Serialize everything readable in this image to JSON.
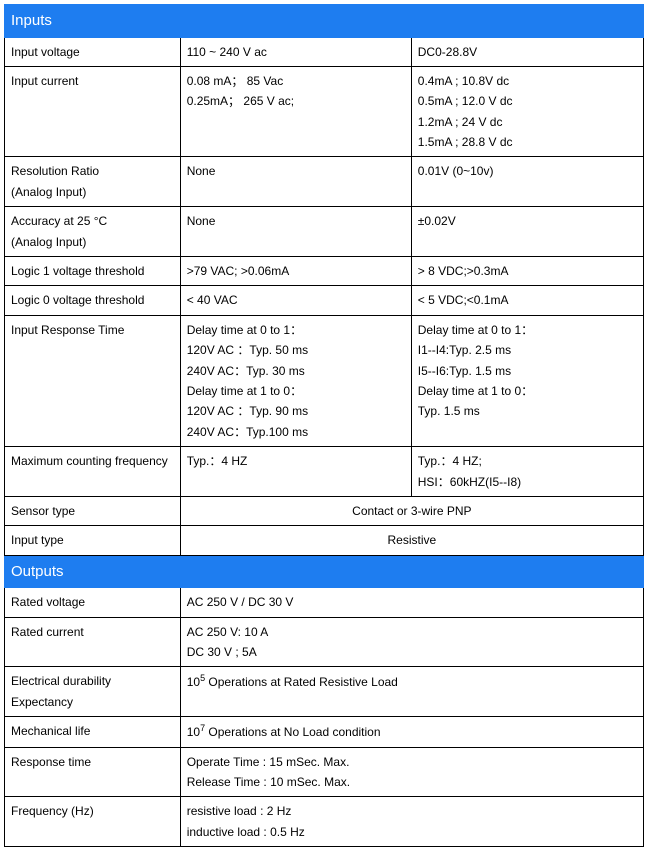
{
  "sections": {
    "inputs_header": "Inputs",
    "outputs_header": "Outputs"
  },
  "inputs": {
    "input_voltage": {
      "label": "Input voltage",
      "c2": "110 ~ 240 V ac",
      "c3": "DC0-28.8V"
    },
    "input_current": {
      "label": "Input current",
      "c2": "0.08 mA；  85 Vac\n0.25mA；  265 V ac;",
      "c3": "0.4mA ; 10.8V dc\n0.5mA ; 12.0 V dc\n1.2mA ; 24 V dc\n1.5mA ; 28.8 V dc"
    },
    "resolution_ratio": {
      "label": " Resolution Ratio\n(Analog Input)",
      "c2": "None",
      "c3": "0.01V    (0~10v)"
    },
    "accuracy": {
      "label": "Accuracy at 25 °C\n(Analog Input)",
      "c2": "None",
      "c3": "±0.02V"
    },
    "logic1": {
      "label": "Logic 1 voltage threshold",
      "c2": ">79 VAC; >0.06mA",
      "c3": "> 8 VDC;>0.3mA"
    },
    "logic0": {
      "label": "Logic 0 voltage threshold",
      "c2": "< 40 VAC",
      "c3": "< 5 VDC;<0.1mA"
    },
    "response_time": {
      "label": "Input Response Time",
      "c2": "Delay time at 0 to 1：\n120V AC ：Typ. 50 ms\n240V AC：Typ. 30 ms\nDelay time at 1 to 0：\n120V AC ：Typ. 90 ms\n240V AC：Typ.100 ms",
      "c3": "Delay time at 0 to 1：\nI1--I4:Typ. 2.5 ms\nI5--I6:Typ. 1.5 ms\nDelay time at 1 to 0：\nTyp. 1.5 ms"
    },
    "max_freq": {
      "label": "Maximum counting frequency",
      "c2": "Typ.：4 HZ",
      "c3": "Typ.：4 HZ;\nHSI：60kHZ(I5--I8)"
    },
    "sensor_type": {
      "label": "Sensor type",
      "merged": "Contact or 3-wire PNP"
    },
    "input_type": {
      "label": "Input type",
      "merged": "Resistive"
    }
  },
  "outputs": {
    "rated_voltage": {
      "label": "Rated voltage",
      "merged": "AC 250 V / DC 30 V"
    },
    "rated_current": {
      "label": "Rated current",
      "merged": "AC 250 V: 10 A\nDC 30 V ; 5A"
    },
    "durability": {
      "label": "Electrical durability Expectancy",
      "merged_pre": "10",
      "merged_sup": "5",
      "merged_post": " Operations at Rated Resistive Load"
    },
    "mech_life": {
      "label": "Mechanical life",
      "merged_pre": "10",
      "merged_sup": "7",
      "merged_post": " Operations at No Load condition"
    },
    "response_time": {
      "label": "Response time",
      "merged": "Operate Time : 15 mSec. Max.\nRelease Time : 10 mSec. Max."
    },
    "frequency": {
      "label": "Frequency (Hz)",
      "merged": "resistive load :    2 Hz\ninductive load :    0.5 Hz"
    }
  }
}
